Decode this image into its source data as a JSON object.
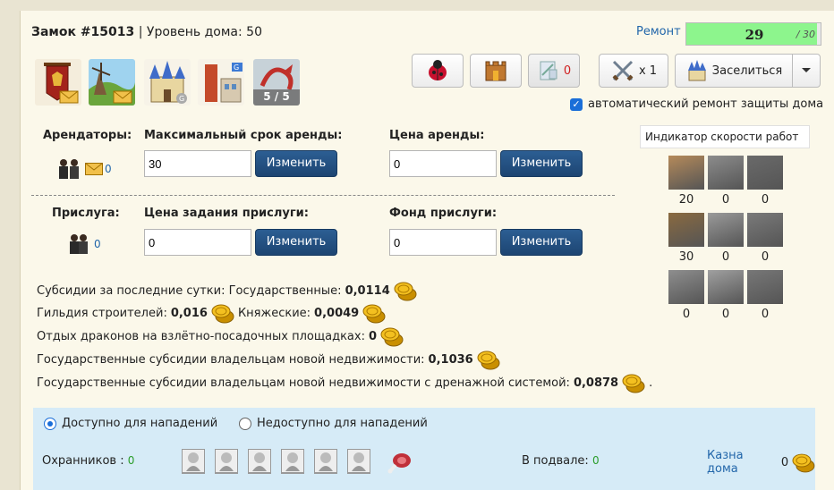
{
  "header": {
    "castle": "Замок #15013",
    "sep": "|",
    "level_label": "Уровень дома:",
    "level": "50",
    "repair_label": "Ремонт",
    "repair_value": "29",
    "repair_max": "/ 30",
    "repair_fraction": 0.97
  },
  "toolbar": {
    "icon3_count": "0",
    "swords_count": "x 1",
    "settle_label": "Заселиться",
    "slot_badge": "5 / 5"
  },
  "auto_repair": "автоматический ремонт защиты дома",
  "tenants": {
    "label": "Арендаторы:",
    "count": "0",
    "max_term_label": "Максимальный срок аренды:",
    "max_term_value": "30",
    "price_label": "Цена аренды:",
    "price_value": "0",
    "change": "Изменить"
  },
  "servants": {
    "label": "Прислуга:",
    "count": "0",
    "task_price_label": "Цена задания прислуги:",
    "task_price_value": "0",
    "fund_label": "Фонд прислуги:",
    "fund_value": "0",
    "change": "Изменить"
  },
  "speed": {
    "title": "Индикатор скорости работ",
    "values": [
      "20",
      "0",
      "0",
      "30",
      "0",
      "0",
      "0",
      "0",
      "0"
    ]
  },
  "subsidies": {
    "l1_text": "Субсидии за последние сутки: Государственные:",
    "l1_val": "0,0114",
    "l2_text": "Гильдия строителей:",
    "l2_val": "0,016",
    "l2b_text": "Княжеские:",
    "l2b_val": "0,0049",
    "l3_text": "Отдых драконов на взлётно-посадочных площадках:",
    "l3_val": "0",
    "l4_text": "Государственные субсидии владельцам новой недвижимости:",
    "l4_val": "0,1036",
    "l5_text": "Государственные субсидии владельцам новой недвижимости с дренажной системой:",
    "l5_val": "0,0878",
    "l5_end": "."
  },
  "attack": {
    "available": "Доступно для нападений",
    "unavailable": "Недоступно для нападений",
    "guards_label": "Охранников :",
    "guards_count": "0",
    "basement_label": "В подвале:",
    "basement_count": "0",
    "treasury_label": "Казна дома",
    "treasury_count": "0"
  },
  "colors": {
    "panel": "#fbf8ea",
    "repair_fill": "#8df58d",
    "button": "#1d4572",
    "bottom": "#d6ebf7",
    "link": "#2266aa",
    "green": "#2a9d2a"
  }
}
